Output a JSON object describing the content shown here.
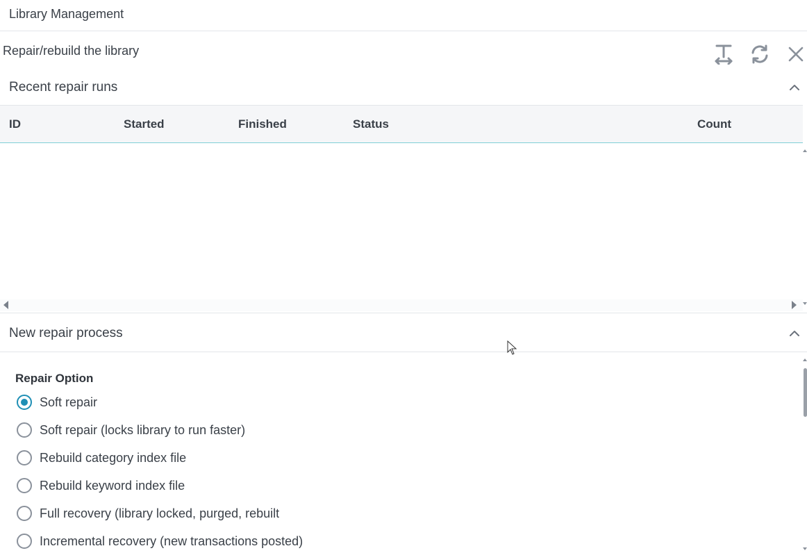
{
  "app": {
    "title": "Library Management"
  },
  "panel": {
    "title": "Repair/rebuild the library",
    "tools": [
      {
        "name": "fit-width-icon"
      },
      {
        "name": "refresh-icon"
      },
      {
        "name": "close-icon"
      }
    ]
  },
  "recent_runs": {
    "title": "Recent repair runs",
    "columns": [
      "ID",
      "Started",
      "Finished",
      "Status",
      "Count"
    ],
    "rows": []
  },
  "new_repair": {
    "title": "New repair process",
    "group_label": "Repair Option",
    "options": [
      {
        "label": "Soft repair",
        "checked": true
      },
      {
        "label": "Soft repair (locks library to run faster)",
        "checked": false
      },
      {
        "label": "Rebuild category index file",
        "checked": false
      },
      {
        "label": "Rebuild keyword index file",
        "checked": false
      },
      {
        "label": "Full recovery (library locked, purged, rebuilt",
        "checked": false
      },
      {
        "label": "Incremental recovery (new transactions posted)",
        "checked": false
      }
    ]
  },
  "colors": {
    "accent": "#1f8fb5",
    "header_underline": "#7fd0d6",
    "icon": "#8a919b"
  }
}
